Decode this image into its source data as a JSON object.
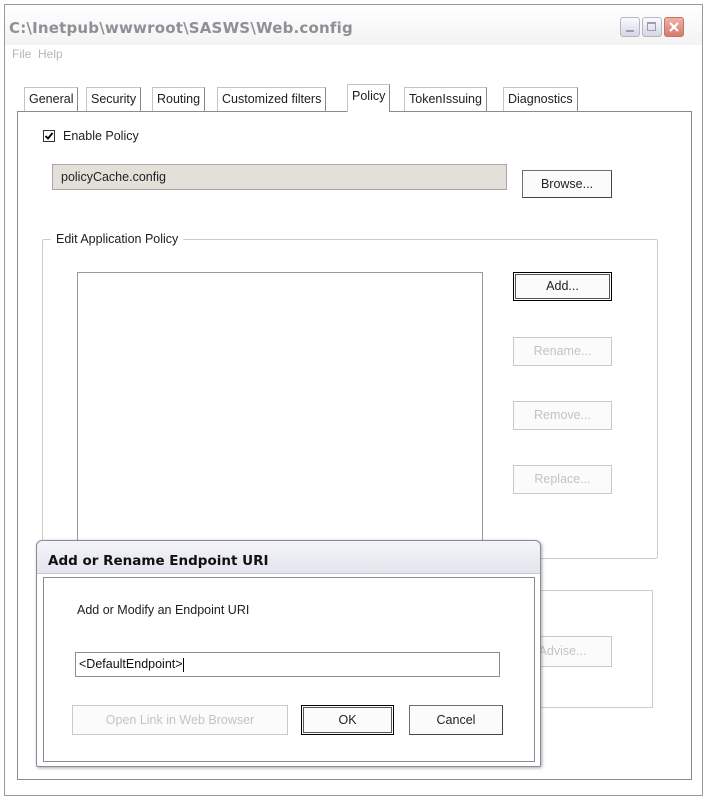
{
  "window": {
    "title": "C:\\Inetpub\\wwwroot\\SASWS\\Web.config",
    "menu": [
      "File",
      "Help"
    ]
  },
  "tabs": [
    {
      "label": "General"
    },
    {
      "label": "Security"
    },
    {
      "label": "Routing"
    },
    {
      "label": "Customized filters"
    },
    {
      "label": "Policy"
    },
    {
      "label": "TokenIssuing"
    },
    {
      "label": "Diagnostics"
    }
  ],
  "active_tab": "Policy",
  "policy": {
    "enable_label": "Enable Policy",
    "enabled": true,
    "file_value": "policyCache.config",
    "browse_label": "Browse..."
  },
  "app_policy": {
    "group_title": "Edit Application Policy",
    "items": [],
    "add_label": "Add...",
    "rename_label": "Rename...",
    "remove_label": "Remove...",
    "replace_label": "Replace..."
  },
  "advise": {
    "label": "Advise..."
  },
  "dialog": {
    "title": "Add or Rename Endpoint URI",
    "prompt": "Add or Modify an Endpoint URI",
    "input_value": "<DefaultEndpoint>",
    "open_link_label": "Open Link in Web Browser",
    "ok_label": "OK",
    "cancel_label": "Cancel"
  },
  "colors": {
    "field_bg": "#e3e0d9",
    "disabled_text": "#c3c3c3",
    "close_button": "#d47a6c"
  }
}
